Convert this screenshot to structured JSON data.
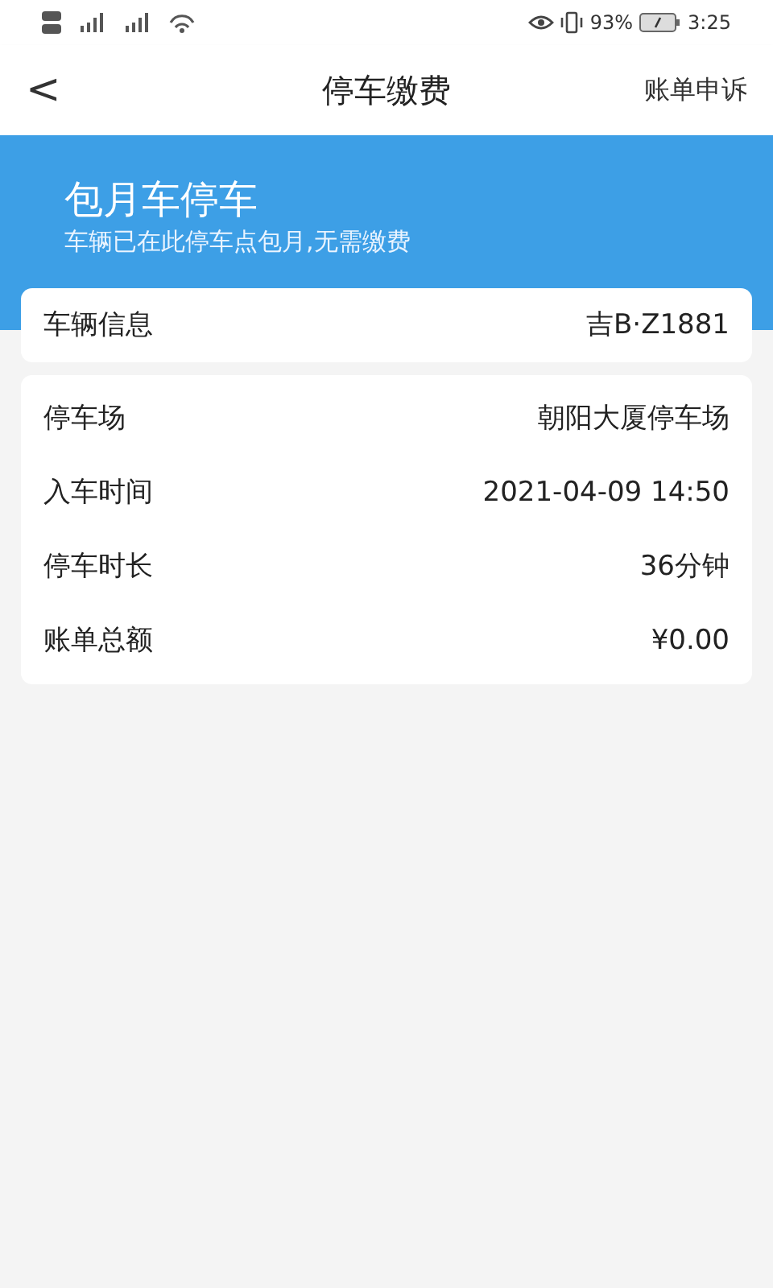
{
  "status_bar": {
    "battery": "93%",
    "time": "3:25"
  },
  "header": {
    "back": "<",
    "title": "停车缴费",
    "action": "账单申诉"
  },
  "banner": {
    "title": "包月车停车",
    "subtitle": "车辆已在此停车点包月,无需缴费"
  },
  "vehicle": {
    "label": "车辆信息",
    "value": "吉B·Z1881"
  },
  "details": [
    {
      "label": "停车场",
      "value": "朝阳大厦停车场"
    },
    {
      "label": "入车时间",
      "value": "2021-04-09 14:50"
    },
    {
      "label": "停车时长",
      "value": "36分钟"
    },
    {
      "label": "账单总额",
      "value": "¥0.00"
    }
  ]
}
